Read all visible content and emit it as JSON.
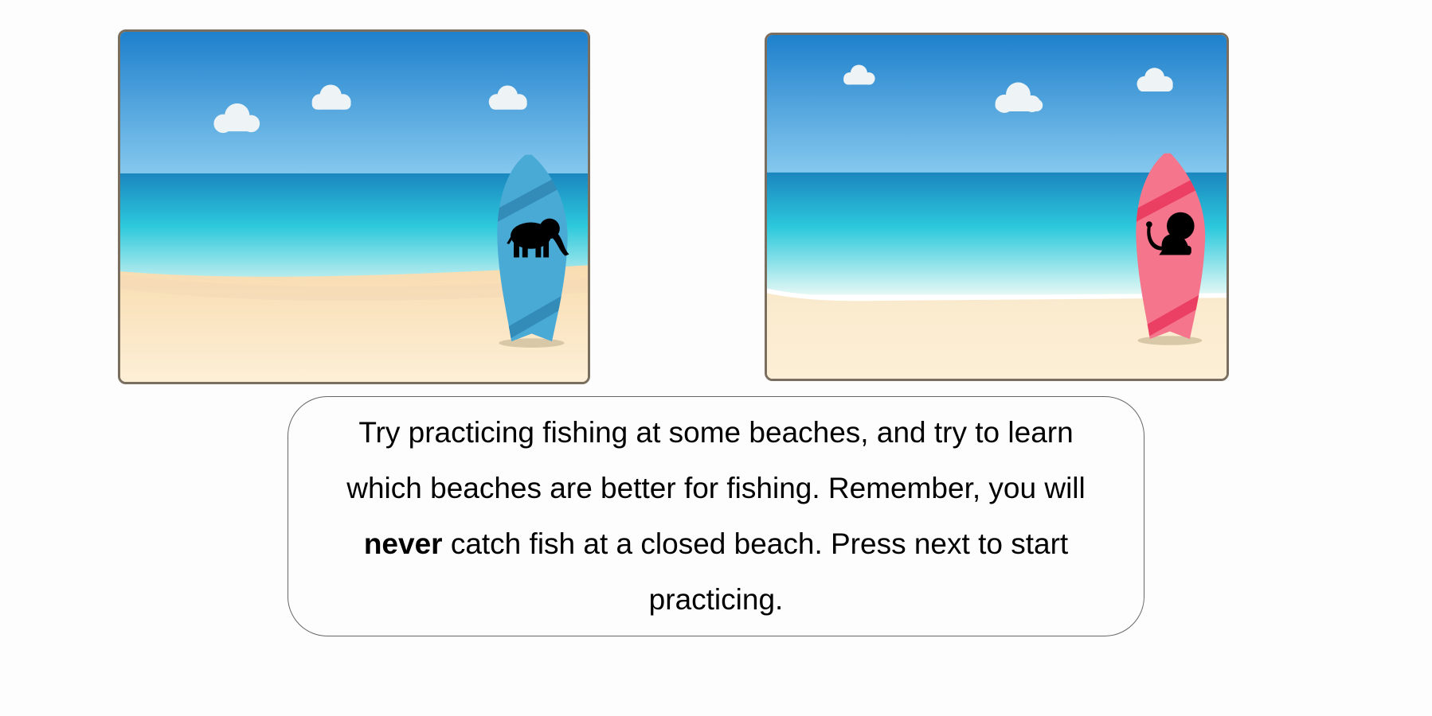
{
  "beaches": [
    {
      "id": "left",
      "board_color": "#4aaad6",
      "board_stripe_color": "#2f86b3",
      "animal_icon": "elephant-icon"
    },
    {
      "id": "right",
      "board_color": "#f4758c",
      "board_stripe_color": "#ea3a5e",
      "animal_icon": "lion-icon"
    }
  ],
  "instructions": {
    "part1": "Try practicing fishing at some beaches, and try to learn which beaches are better for fishing. Remember, you will",
    "emphasis": "never",
    "part2": "catch fish at a closed beach. Press next to start practicing."
  }
}
